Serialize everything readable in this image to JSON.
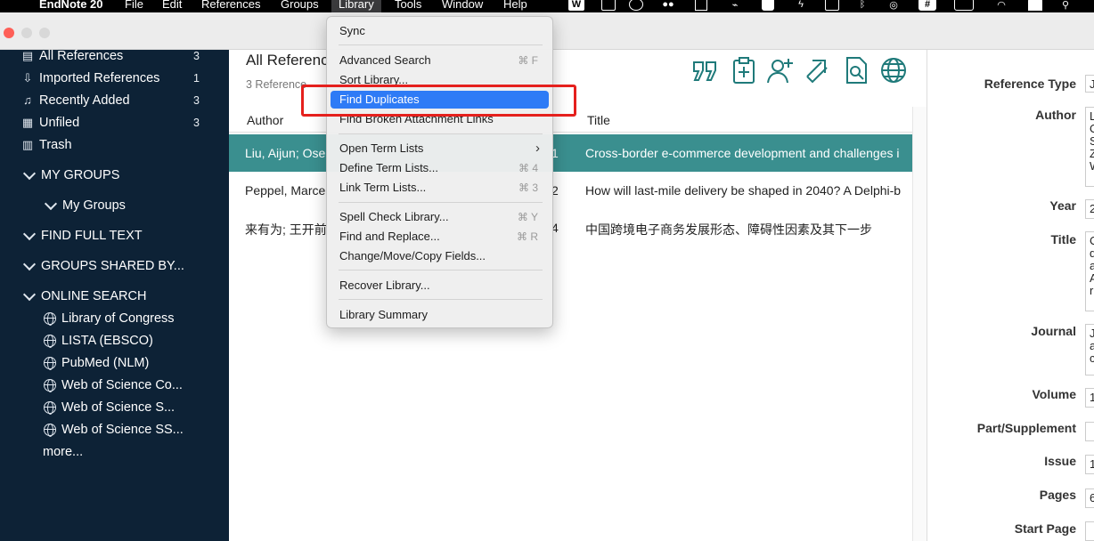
{
  "menubar": {
    "apple": "",
    "app_name": "EndNote 20",
    "items": [
      "File",
      "Edit",
      "References",
      "Groups",
      "Library",
      "Tools",
      "Window",
      "Help"
    ]
  },
  "sidebar": {
    "top_items": [
      {
        "label": "All References",
        "count": "3",
        "icon": "clipboard-icon"
      },
      {
        "label": "Imported References",
        "count": "1",
        "icon": "import-icon"
      },
      {
        "label": "Recently Added",
        "count": "3",
        "icon": "bell-icon"
      },
      {
        "label": "Unfiled",
        "count": "3",
        "icon": "document-icon"
      },
      {
        "label": "Trash",
        "count": "",
        "icon": "trash-icon"
      }
    ],
    "my_groups": "MY GROUPS",
    "my_groups_child": "My Groups",
    "find_full_text": "FIND FULL TEXT",
    "groups_shared": "GROUPS SHARED BY...",
    "online_search": "ONLINE SEARCH",
    "online_items": [
      "Library of Congress",
      "LISTA (EBSCO)",
      "PubMed (NLM)",
      "Web of Science Co...",
      "Web of Science S...",
      "Web of Science SS..."
    ],
    "more": "more..."
  },
  "main": {
    "library_title": "All Referenc",
    "ref_count": "3 Reference",
    "columns": {
      "author": "Author",
      "title": "Title"
    },
    "rows": [
      {
        "author": "Liu, Aijun; Ose",
        "year_digit": "1",
        "title": "Cross-border e-commerce development and challenges i",
        "selected": true
      },
      {
        "author": "Peppel, Marce",
        "year_digit": "2",
        "title": "How will last-mile delivery be shaped in 2040? A Delphi-b",
        "selected": false
      },
      {
        "author": "来有为; 王开前",
        "year_digit": "4",
        "title": "中国跨境电子商务发展形态、障碍性因素及其下一步",
        "selected": false
      }
    ],
    "toolbar_icons": [
      "quote-icon",
      "add-reference-icon",
      "add-user-icon",
      "share-arrow-icon",
      "find-pdf-icon",
      "online-globe-icon"
    ]
  },
  "right_panel": {
    "fields": [
      {
        "label": "Reference Type",
        "value": "J"
      },
      {
        "label": "Author",
        "value": "L\nO\nS\nZ\nW"
      },
      {
        "label": "Year",
        "value": "2"
      },
      {
        "label": "Title",
        "value": "C\nd\na\nA\nr"
      },
      {
        "label": "Journal",
        "value": "J\na\nc"
      },
      {
        "label": "Volume",
        "value": "1"
      },
      {
        "label": "Part/Supplement",
        "value": ""
      },
      {
        "label": "Issue",
        "value": "1"
      },
      {
        "label": "Pages",
        "value": "6"
      },
      {
        "label": "Start Page",
        "value": ""
      }
    ]
  },
  "library_menu": {
    "sync": "Sync",
    "advanced_search": "Advanced Search",
    "advanced_search_sc": "⌘ F",
    "sort_library": "Sort Library...",
    "find_duplicates": "Find Duplicates",
    "find_broken": "Find Broken Attachment Links",
    "open_term_lists": "Open Term Lists",
    "define_term_lists": "Define Term Lists...",
    "define_term_lists_sc": "⌘ 4",
    "link_term_lists": "Link Term Lists...",
    "link_term_lists_sc": "⌘ 3",
    "spell_check": "Spell Check Library...",
    "spell_check_sc": "⌘ Y",
    "find_replace": "Find and Replace...",
    "find_replace_sc": "⌘ R",
    "change_move_copy": "Change/Move/Copy Fields...",
    "recover_library": "Recover Library...",
    "library_summary": "Library Summary"
  },
  "colors": {
    "sidebar_bg": "#0d2236",
    "selection": "#3a8f8f",
    "menu_highlight": "#2e7bf6",
    "annotation_red": "#e5201d",
    "toolbar_icon": "#1f7a7a"
  }
}
